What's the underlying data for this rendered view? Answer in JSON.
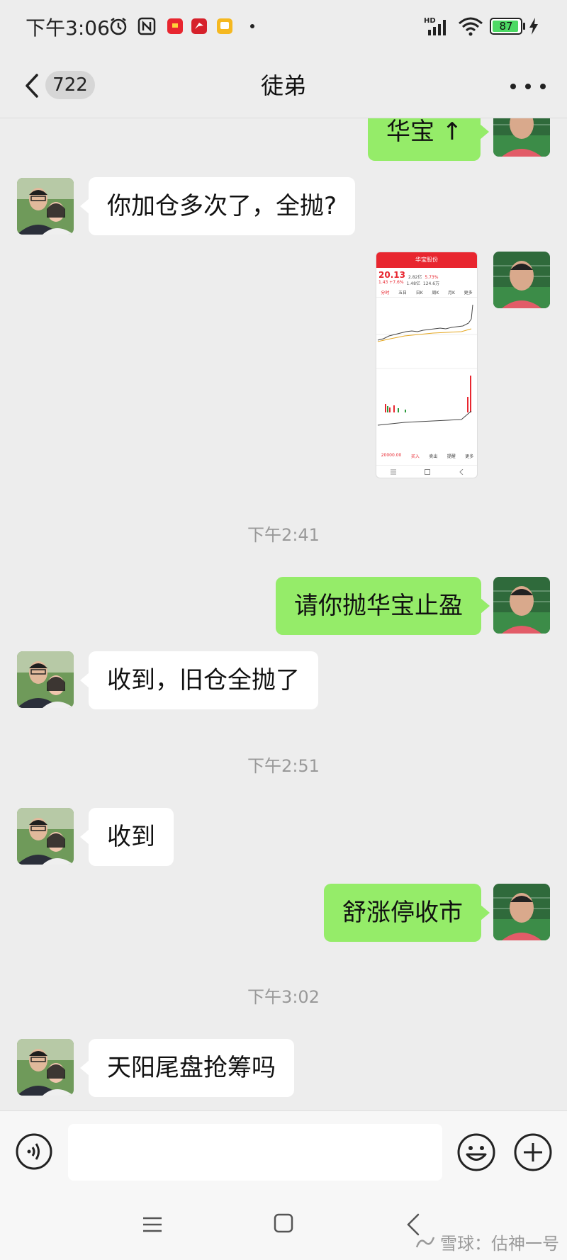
{
  "status_bar": {
    "time": "下午3:06",
    "network": "HD",
    "battery": "87"
  },
  "header": {
    "unread_count": "722",
    "title": "徒弟"
  },
  "messages": [
    {
      "side": "right",
      "text": "华宝 ↑"
    },
    {
      "side": "left",
      "text": "你加仓多次了，全抛?"
    },
    {
      "side": "right",
      "type": "image",
      "image": {
        "app_title": "华宝股份",
        "price": "20.13",
        "change": "1.43 +7.6%",
        "tabs": [
          "分时",
          "五日",
          "日K",
          "周K",
          "月K",
          "更多"
        ],
        "stats": [
          "2.82亿",
          "5.73%",
          "1.48亿",
          "124.6万"
        ],
        "bottom_items": [
          "20000.00",
          "买入",
          "卖出",
          "提醒",
          "更多"
        ]
      }
    },
    {
      "type": "timestamp",
      "text": "下午2:41"
    },
    {
      "side": "right",
      "text": "请你抛华宝止盈"
    },
    {
      "side": "left",
      "text": "收到，旧仓全抛了"
    },
    {
      "type": "timestamp",
      "text": "下午2:51"
    },
    {
      "side": "left",
      "text": "收到"
    },
    {
      "side": "right",
      "text": "舒涨停收市"
    },
    {
      "type": "timestamp",
      "text": "下午3:02"
    },
    {
      "side": "left",
      "text": "天阳尾盘抢筹吗"
    }
  ],
  "input": {
    "placeholder": ""
  },
  "watermark": {
    "text": "雪球：估神一号"
  },
  "colors": {
    "background": "#ededed",
    "bubble_right": "#95ec69",
    "bubble_left": "#ffffff",
    "stock_red": "#e8262f"
  }
}
